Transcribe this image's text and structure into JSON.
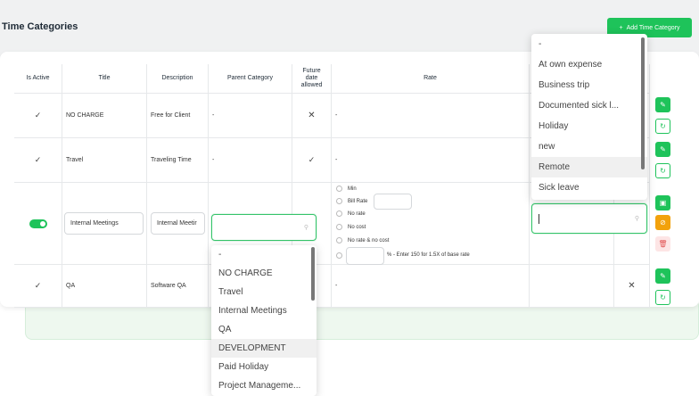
{
  "page": {
    "title": "Time Categories",
    "add_button": "Add Time Category",
    "add_icon": "+"
  },
  "table": {
    "headers": {
      "is_active": "Is Active",
      "title": "Title",
      "description": "Description",
      "parent_category": "Parent Category",
      "future": "Future\ndate\nallowed",
      "rate": "Rate"
    },
    "rows": [
      {
        "title": "NO CHARGE",
        "description": "Free for Client",
        "parent": "-",
        "future": "✕",
        "rate": "-"
      },
      {
        "title": "Travel",
        "description": "Traveling Time",
        "parent": "-",
        "future": "✓",
        "rate": "-"
      },
      {
        "title": "Internal Meetings",
        "description": "Internal Meetir"
      },
      {
        "title": "QA",
        "description": "Software QA",
        "rate": "-",
        "extra": "✕"
      }
    ],
    "check": "✓"
  },
  "rate_options": {
    "min": "Min",
    "bill_rate": "Bill Rate",
    "no_rate": "No rate",
    "no_cost": "No cost",
    "no_rate_no_cost": "No rate & no cost",
    "percent_hint": "% - Enter 150 for 1.5X of base rate"
  },
  "parent_dropdown": {
    "items": [
      "-",
      "NO CHARGE",
      "Travel",
      "Internal Meetings",
      "QA",
      "DEVELOPMENT",
      "Paid Holiday",
      "Project Manageme..."
    ],
    "highlighted": "DEVELOPMENT"
  },
  "right_dropdown": {
    "items": [
      "-",
      "At own expense",
      "Business trip",
      "Documented sick l...",
      "Holiday",
      "new",
      "Remote",
      "Sick leave"
    ],
    "highlighted": "Remote"
  },
  "colors": {
    "accent": "#1ec35a",
    "warning": "#f2a20c",
    "danger": "#e25555"
  }
}
